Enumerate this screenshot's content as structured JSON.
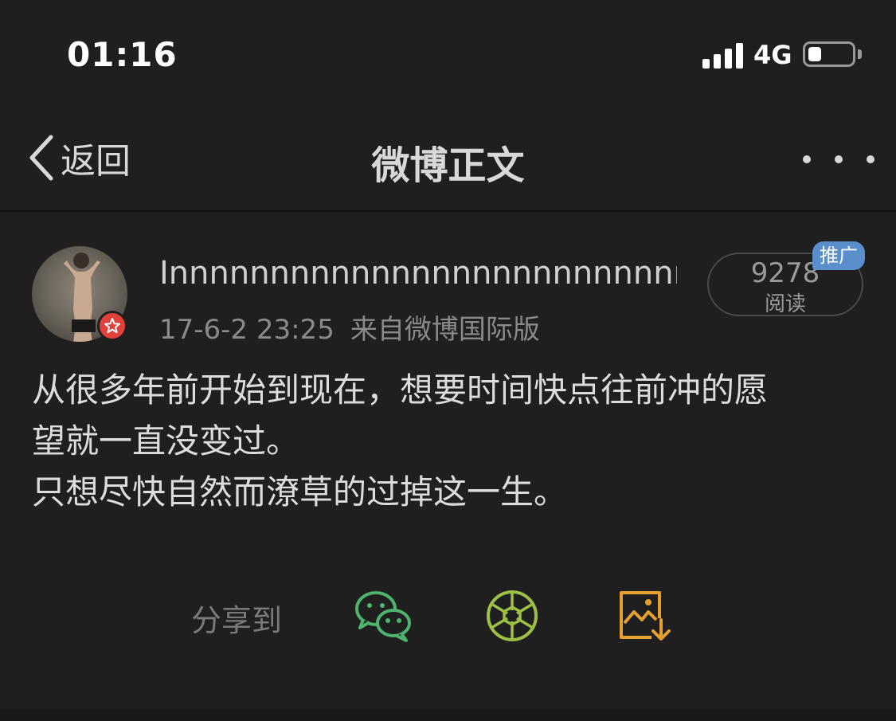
{
  "status_bar": {
    "time": "01:16",
    "network": "4G",
    "battery_level": 0.3
  },
  "nav": {
    "back_label": "返回",
    "title": "微博正文"
  },
  "post": {
    "username": "Innnnnnnnnnnnnnnnnnnnnnnnnnn...",
    "date": "17-6-2 23:25",
    "source": "来自微博国际版",
    "read_count": "9278",
    "read_label": "阅读",
    "promo_tag": "推广",
    "body": "从很多年前开始到现在，想要时间快点往前冲的愿\n望就一直没变过。\n只想尽快自然而潦草的过掉这一生。"
  },
  "share": {
    "label": "分享到",
    "targets": [
      {
        "icon": "wechat-icon",
        "color": "#4eb36c"
      },
      {
        "icon": "moments-icon",
        "color": "#9ec044"
      },
      {
        "icon": "save-image-icon",
        "color": "#e6a030"
      }
    ]
  }
}
